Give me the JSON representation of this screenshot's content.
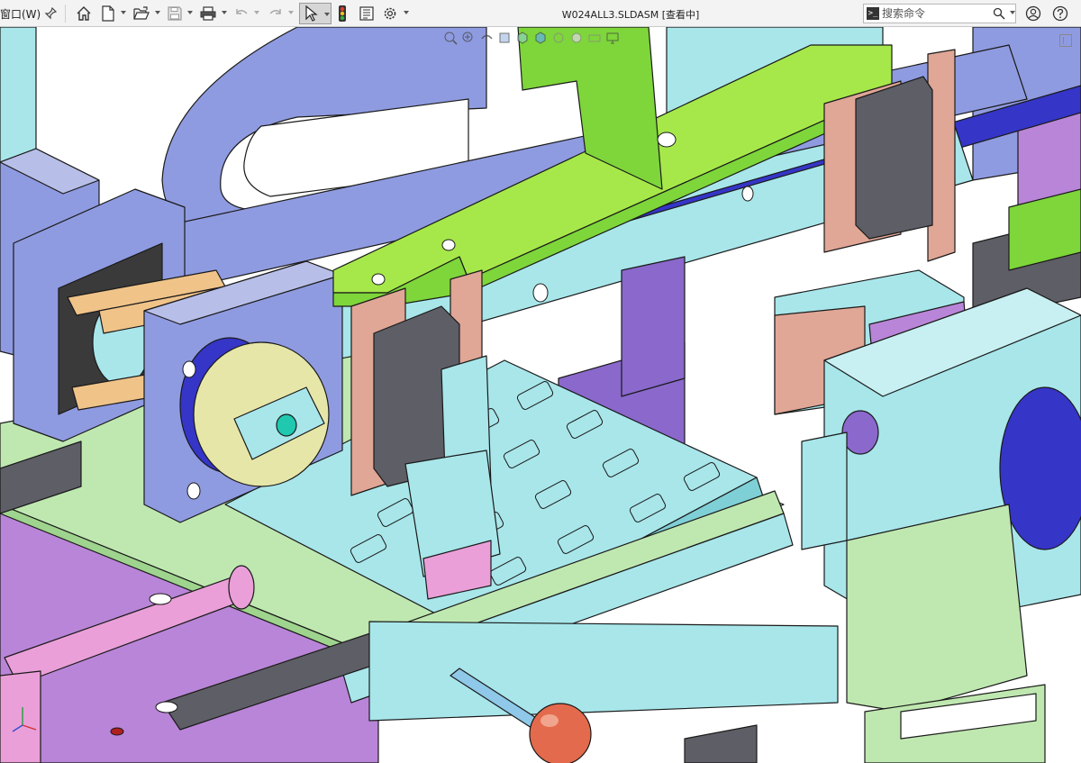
{
  "menu": {
    "window_label": "窗口(W)"
  },
  "toolbar": {
    "icons": [
      "pin-icon",
      "home-icon",
      "new-document-icon",
      "open-icon",
      "save-icon",
      "print-icon",
      "undo-icon",
      "redo-icon",
      "select-cursor-icon",
      "rebuild-traffic-light-icon",
      "file-properties-icon",
      "options-gear-icon"
    ]
  },
  "document": {
    "title": "W024ALL3.SLDASM [查看中]"
  },
  "search": {
    "placeholder": "搜索命令"
  },
  "view": {
    "hud_icons": [
      "zoom-to-fit-icon",
      "zoom-area-icon",
      "previous-view-icon",
      "section-view-icon",
      "view-orientation-icon",
      "display-style-icon",
      "hide-show-icon",
      "appearance-icon",
      "scene-icon",
      "display-settings-icon"
    ],
    "colors": {
      "lime": "#a6e84a",
      "green": "#7ed63a",
      "lavender": "#8f9be0",
      "cyan": "#a8e6ea",
      "light_green": "#bfe8b0",
      "purple": "#8a68cc",
      "violet": "#b985d8",
      "salmon": "#e0a696",
      "pink": "#ea9fd8",
      "blue": "#3535c8",
      "dark_gray": "#5e5e66",
      "orange_ball": "#e36a4c"
    }
  }
}
